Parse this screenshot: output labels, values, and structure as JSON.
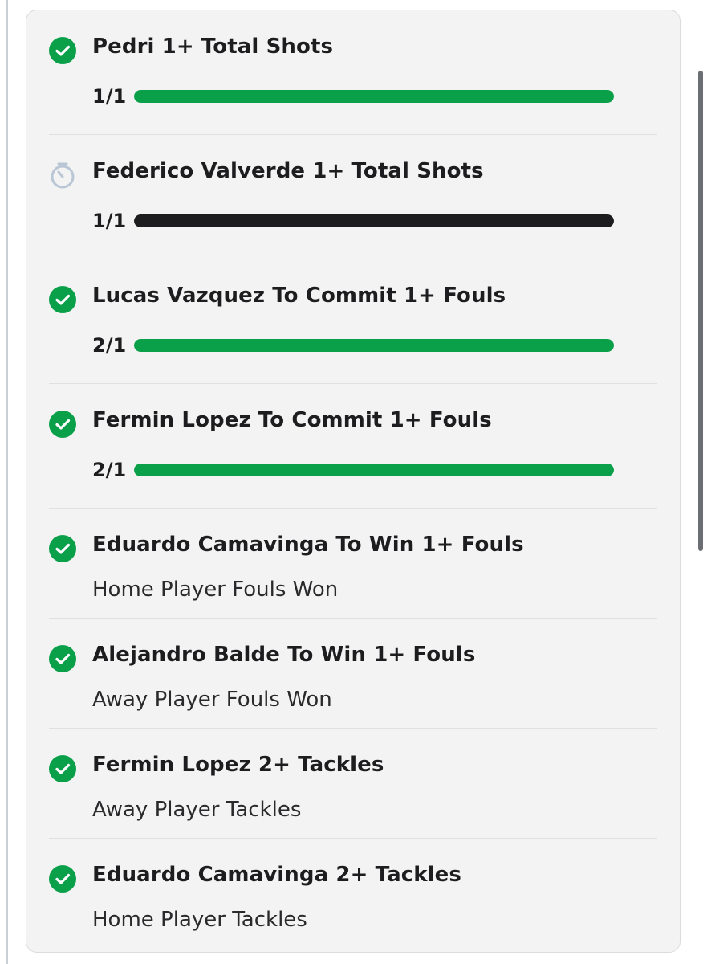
{
  "colors": {
    "success_green": "#0aa04a",
    "pending_dark": "#1d1d1f",
    "pending_icon": "#b9c6d6"
  },
  "legs": [
    {
      "title": "Pedri 1+ Total Shots",
      "status": "won",
      "icon": "check-circle-icon",
      "progress": {
        "label": "1/1",
        "fraction": 1.0,
        "color": "#0aa04a"
      }
    },
    {
      "title": "Federico Valverde 1+ Total Shots",
      "status": "pending",
      "icon": "stopwatch-icon",
      "progress": {
        "label": "1/1",
        "fraction": 1.0,
        "color": "#1d1d1f"
      }
    },
    {
      "title": "Lucas Vazquez To Commit 1+ Fouls",
      "status": "won",
      "icon": "check-circle-icon",
      "progress": {
        "label": "2/1",
        "fraction": 1.0,
        "color": "#0aa04a"
      }
    },
    {
      "title": "Fermin Lopez To Commit 1+ Fouls",
      "status": "won",
      "icon": "check-circle-icon",
      "progress": {
        "label": "2/1",
        "fraction": 1.0,
        "color": "#0aa04a"
      }
    },
    {
      "title": "Eduardo Camavinga To Win 1+ Fouls",
      "status": "won",
      "icon": "check-circle-icon",
      "subtitle": "Home Player Fouls Won"
    },
    {
      "title": "Alejandro Balde To Win 1+ Fouls",
      "status": "won",
      "icon": "check-circle-icon",
      "subtitle": "Away Player Fouls Won"
    },
    {
      "title": "Fermin Lopez 2+ Tackles",
      "status": "won",
      "icon": "check-circle-icon",
      "subtitle": "Away Player Tackles"
    },
    {
      "title": "Eduardo Camavinga 2+ Tackles",
      "status": "won",
      "icon": "check-circle-icon",
      "subtitle": "Home Player Tackles"
    }
  ]
}
